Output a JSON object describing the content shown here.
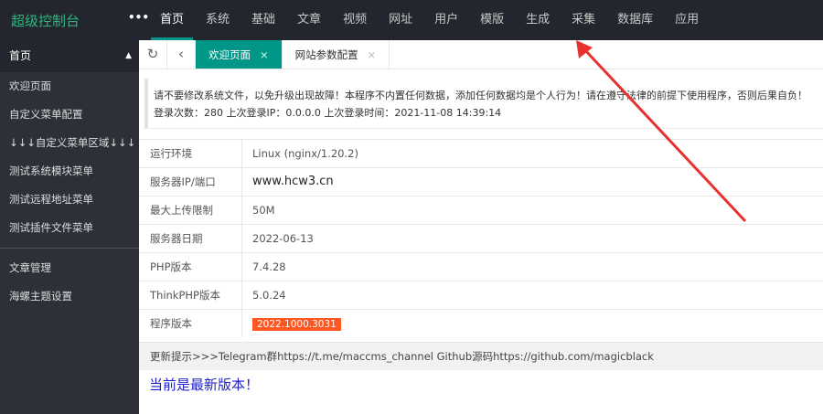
{
  "header": {
    "logo": "超级控制台",
    "more": "•••",
    "nav": [
      "首页",
      "系统",
      "基础",
      "文章",
      "视频",
      "网址",
      "用户",
      "模版",
      "生成",
      "采集",
      "数据库",
      "应用"
    ]
  },
  "sidebar": {
    "head": "首页",
    "items": [
      "欢迎页面",
      "自定义菜单配置",
      "↓↓↓自定义菜单区域↓↓↓",
      "测试系统模块菜单",
      "测试远程地址菜单",
      "测试插件文件菜单"
    ],
    "lower": [
      "文章管理",
      "海螺主题设置"
    ]
  },
  "tabs": {
    "items": [
      {
        "label": "欢迎页面",
        "active": true
      },
      {
        "label": "网站参数配置",
        "active": false
      }
    ],
    "close": "×",
    "refresh": "↻",
    "back": "‹"
  },
  "notice": {
    "line1": "请不要修改系统文件，以免升级出现故障！本程序不内置任何数据，添加任何数据均是个人行为！请在遵守法律的前提下使用程序，否则后果自负！",
    "line2": "登录次数：280 上次登录IP：0.0.0.0 上次登录时间：2021-11-08 14:39:14"
  },
  "info": [
    {
      "k": "运行环境",
      "v": "Linux (nginx/1.20.2)"
    },
    {
      "k": "服务器IP/端口",
      "v": "www.hcw3.cn"
    },
    {
      "k": "最大上传限制",
      "v": "50M"
    },
    {
      "k": "服务器日期",
      "v": "2022-06-13"
    },
    {
      "k": "PHP版本",
      "v": "7.4.28"
    },
    {
      "k": "ThinkPHP版本",
      "v": "5.0.24"
    },
    {
      "k": "程序版本",
      "v": "2022.1000.3031"
    }
  ],
  "update": "更新提示>>>Telegram群https://t.me/maccms_channel   Github源码https://github.com/magicblack",
  "latest": "当前是最新版本！",
  "colors": {
    "accent": "#009688",
    "badge": "#ff5722",
    "arrow": "#e8312f"
  }
}
